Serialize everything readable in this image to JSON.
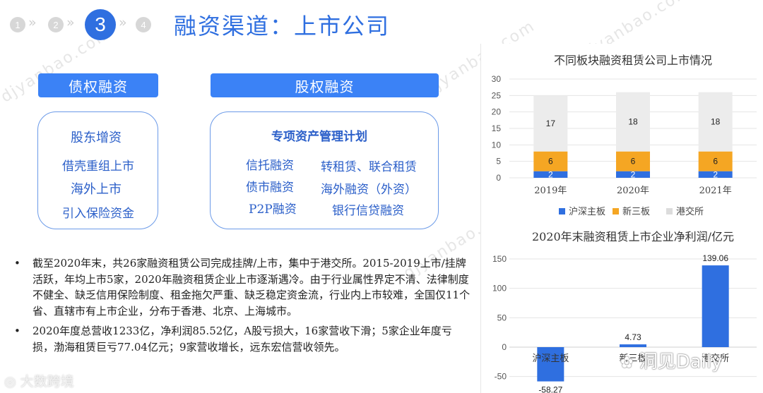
{
  "steps": [
    {
      "num": "1"
    },
    {
      "num": "2"
    },
    {
      "num": "3"
    },
    {
      "num": "4"
    }
  ],
  "title": "融资渠道：上市公司",
  "debt": {
    "header": "债权融资",
    "items": [
      "股东增资",
      "借壳重组上市",
      "海外上市",
      "引入保险资金"
    ]
  },
  "equity": {
    "header": "股权融资",
    "subtitle": "专项资产管理计划",
    "items_left": [
      "信托融资",
      "债市融资",
      "P2P融资"
    ],
    "items_right": [
      "转租赁、联合租赁",
      "海外融资（外资）",
      "银行信贷融资"
    ]
  },
  "bullets": [
    "截至2020年末，共26家融资租赁公司完成挂牌/上市，集中于港交所。2015-2019上市/挂牌活跃，年均上市5家，2020年融资租赁企业上市逐渐遇冷。由于行业属性界定不清、法律制度不健全、缺乏信用保险制度、租金拖欠严重、缺乏稳定资金流，行业内上市较难，全国仅11个省、直辖市有上市企业，分布于香港、北京、上海城市。",
    "2020年度总营收1233亿，净利润85.52亿，A股亏损大，16家营收下滑；5家企业年度亏损，渤海租赁巨亏77.04亿元；9家营收增长，远东宏信营收领先。"
  ],
  "bullet_symbol": "•",
  "watermarks": {
    "brand_left": "大数跨境",
    "brand_right": "洞见Daily",
    "diagonal": "djyanbao.com"
  },
  "chart_data": [
    {
      "type": "bar",
      "stacked": true,
      "title": "不同板块融资租赁公司上市情况",
      "categories": [
        "2019年",
        "2020年",
        "2021年"
      ],
      "series": [
        {
          "name": "沪深主板",
          "values": [
            2,
            2,
            2
          ],
          "color": "#2f6fe0"
        },
        {
          "name": "新三板",
          "values": [
            6,
            6,
            6
          ],
          "color": "#f5a623"
        },
        {
          "name": "港交所",
          "values": [
            17,
            18,
            18
          ],
          "color": "#ececec"
        }
      ],
      "yticks": [
        "0",
        "5",
        "10",
        "15",
        "20",
        "25",
        "30"
      ],
      "ylim": [
        0,
        30
      ],
      "legend": "bottom",
      "grid": true
    },
    {
      "type": "bar",
      "title": "2020年末融资租赁上市企业净利润/亿元",
      "categories": [
        "沪深主板",
        "新三板",
        "港交所"
      ],
      "values": [
        -58.27,
        4.73,
        139.06
      ],
      "value_labels": [
        "-58.27",
        "4.73",
        "139.06"
      ],
      "yticks": [
        "-50",
        "0",
        "50",
        "100",
        "150"
      ],
      "ylim": [
        -60,
        150
      ],
      "color": "#2f6fe0",
      "grid": true
    }
  ]
}
